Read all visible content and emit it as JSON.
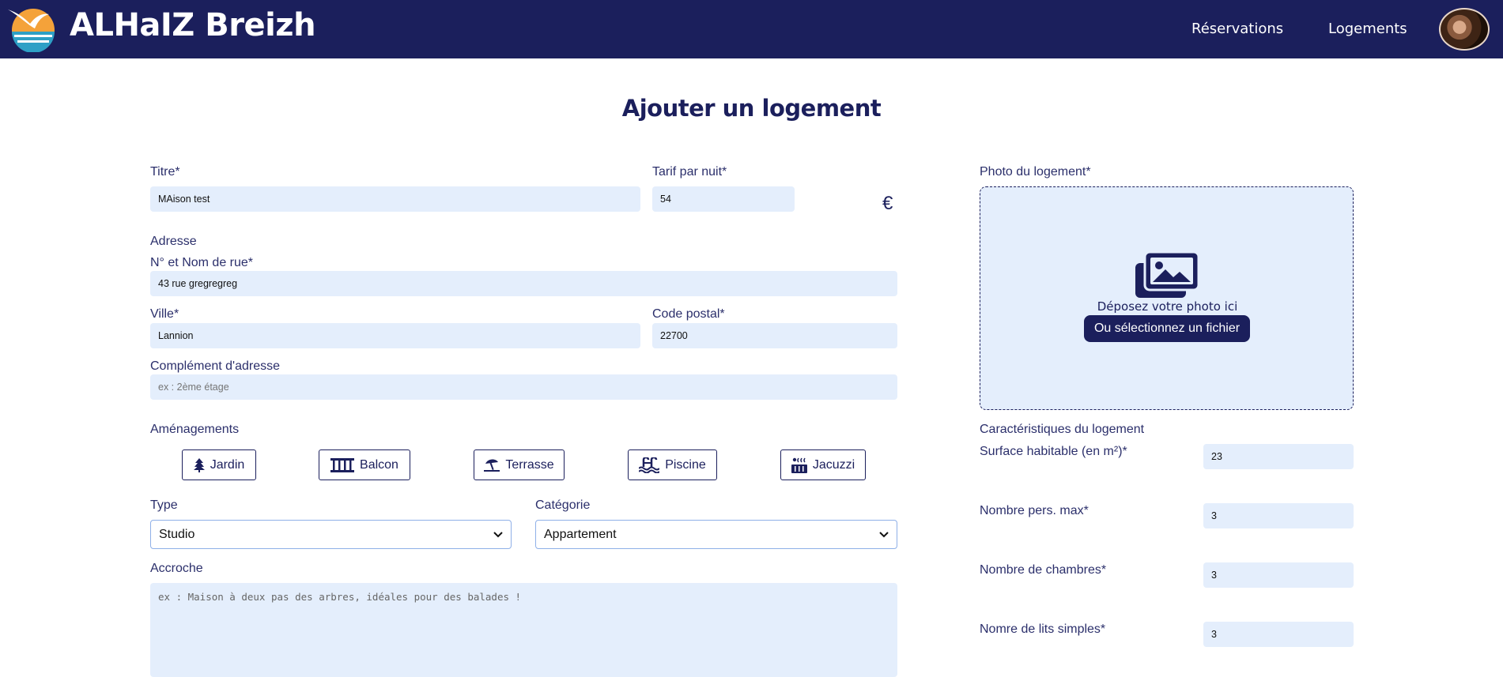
{
  "header": {
    "brand": "ALHaIZ Breizh",
    "nav": [
      "Réservations",
      "Logements"
    ]
  },
  "page_title": "Ajouter un logement",
  "form": {
    "titre": {
      "label": "Titre*",
      "value": "MAison test"
    },
    "tarif": {
      "label": "Tarif par nuit*",
      "value": "54",
      "currency": "€"
    },
    "adresse_heading": "Adresse",
    "rue": {
      "label": "N° et Nom de rue*",
      "value": "43 rue gregregreg"
    },
    "ville": {
      "label": "Ville*",
      "value": "Lannion"
    },
    "code_postal": {
      "label": "Code postal*",
      "value": "22700"
    },
    "complement": {
      "label": "Complément d'adresse",
      "placeholder": "ex : 2ème étage"
    },
    "amenagements": {
      "label": "Aménagements",
      "items": [
        {
          "label": "Jardin",
          "icon": "tree-icon"
        },
        {
          "label": "Balcon",
          "icon": "balcony-icon"
        },
        {
          "label": "Terrasse",
          "icon": "umbrella-beach-icon"
        },
        {
          "label": "Piscine",
          "icon": "pool-icon"
        },
        {
          "label": "Jacuzzi",
          "icon": "hot-tub-icon"
        }
      ]
    },
    "type": {
      "label": "Type",
      "selected": "Studio"
    },
    "categorie": {
      "label": "Catégorie",
      "selected": "Appartement"
    },
    "accroche": {
      "label": "Accroche",
      "placeholder": "ex : Maison à deux pas des arbres, idéales pour des balades !"
    }
  },
  "photo": {
    "label": "Photo du logement*",
    "drop_text": "Déposez votre photo ici",
    "button": "Ou sélectionnez un fichier"
  },
  "caracteristiques": {
    "heading": "Caractéristiques du logement",
    "surface": {
      "label": "Surface habitable (en m²)*",
      "value": "23"
    },
    "pers_max": {
      "label": "Nombre pers. max*",
      "value": "3"
    },
    "chambres": {
      "label": "Nombre de chambres*",
      "value": "3"
    },
    "lits_simples": {
      "label": "Nomre de lits simples*",
      "value": "3"
    }
  },
  "colors": {
    "primary": "#1b1f5c",
    "input_bg": "#e4eefc",
    "select_border": "#8fb0e8"
  }
}
